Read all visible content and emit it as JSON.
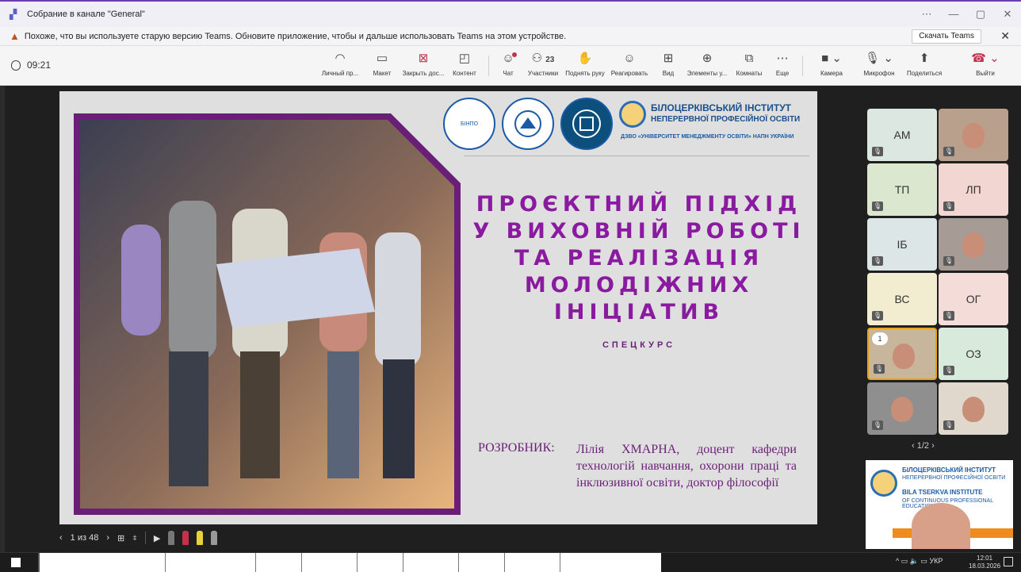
{
  "window": {
    "title": "Собрание в канале \"General\"",
    "controls": [
      "⋯",
      "—",
      "▢",
      "✕"
    ]
  },
  "warning": {
    "text": "Похоже, что вы используете старую версию Teams. Обновите приложение, чтобы и дальше использовать Teams на этом устройстве.",
    "download_label": "Скачать Teams",
    "close": "✕"
  },
  "toolbar": {
    "timer": "09:21",
    "buttons": {
      "personal": "Личный пр...",
      "layout": "Макет",
      "close_content": "Закрыть дос...",
      "content": "Контент",
      "chat": "Чат",
      "participants": "Участники",
      "participants_count": "23",
      "raise_hand": "Поднять руку",
      "react": "Реагировать",
      "view": "Вид",
      "apps": "Элементы у...",
      "rooms": "Комнаты",
      "more": "Еще",
      "camera": "Камера",
      "mic": "Микрофон",
      "share": "Поделиться",
      "leave": "Выйти"
    }
  },
  "slide": {
    "institute_line1": "БІЛОЦЕРКІВСЬКИЙ ІНСТИТУТ",
    "institute_line2": "НЕПЕРЕРВНОЇ ПРОФЕСІЙНОЇ ОСВІТИ",
    "institute_line3": "ДЗВО «УНІВЕРСИТЕТ МЕНЕДЖМЕНТУ ОСВІТИ» НАПН УКРАЇНИ",
    "logo1": "БІНПО",
    "title_lines": [
      "ПРОЄКТНИЙ ПІДХІД",
      "У ВИХОВНІЙ РОБОТІ",
      "ТА РЕАЛІЗАЦІЯ",
      "МОЛОДІЖНИХ",
      "ІНІЦІАТИВ"
    ],
    "subtitle": "СПЕЦКУРС",
    "author_label": "РОЗРОБНИК:",
    "author_text": "Лілія ХМАРНА, доцент кафедри технологій навчання, охорони праці та інклюзивної освіти, доктор філософії"
  },
  "presenter": {
    "page": "1 из 48"
  },
  "participants": {
    "tiles": [
      {
        "initials": "АМ",
        "bg": "#dce7e2"
      },
      {
        "initials": "",
        "bg": ""
      },
      {
        "initials": "ТП",
        "bg": "#dce7d0"
      },
      {
        "initials": "ЛП",
        "bg": "#f2d6d2"
      },
      {
        "initials": "ІБ",
        "bg": "#dce6e6"
      },
      {
        "initials": "",
        "bg": ""
      },
      {
        "initials": "ВС",
        "bg": "#f2edd1"
      },
      {
        "initials": "ОГ",
        "bg": "#f4dcd8"
      },
      {
        "initials": "",
        "bg": ""
      },
      {
        "initials": "ОЗ",
        "bg": "#d8eadc"
      },
      {
        "initials": "",
        "bg": ""
      },
      {
        "initials": "",
        "bg": ""
      }
    ],
    "raised_count": "1",
    "pager": "1/2"
  },
  "promo": {
    "line1": "БІЛОЦЕРКІВСЬКИЙ ІНСТИТУТ",
    "line2": "НЕПЕРЕРВНОЇ ПРОФЕСІЙНОЇ ОСВІТИ",
    "line3": "BILA TSERKVA INSTITUTE",
    "line4": "OF CONTINUOUS PROFESSIONAL EDUCATION"
  },
  "taskbar": {
    "lang": "УКР",
    "time": "12:01",
    "date": "18.03.2026"
  }
}
